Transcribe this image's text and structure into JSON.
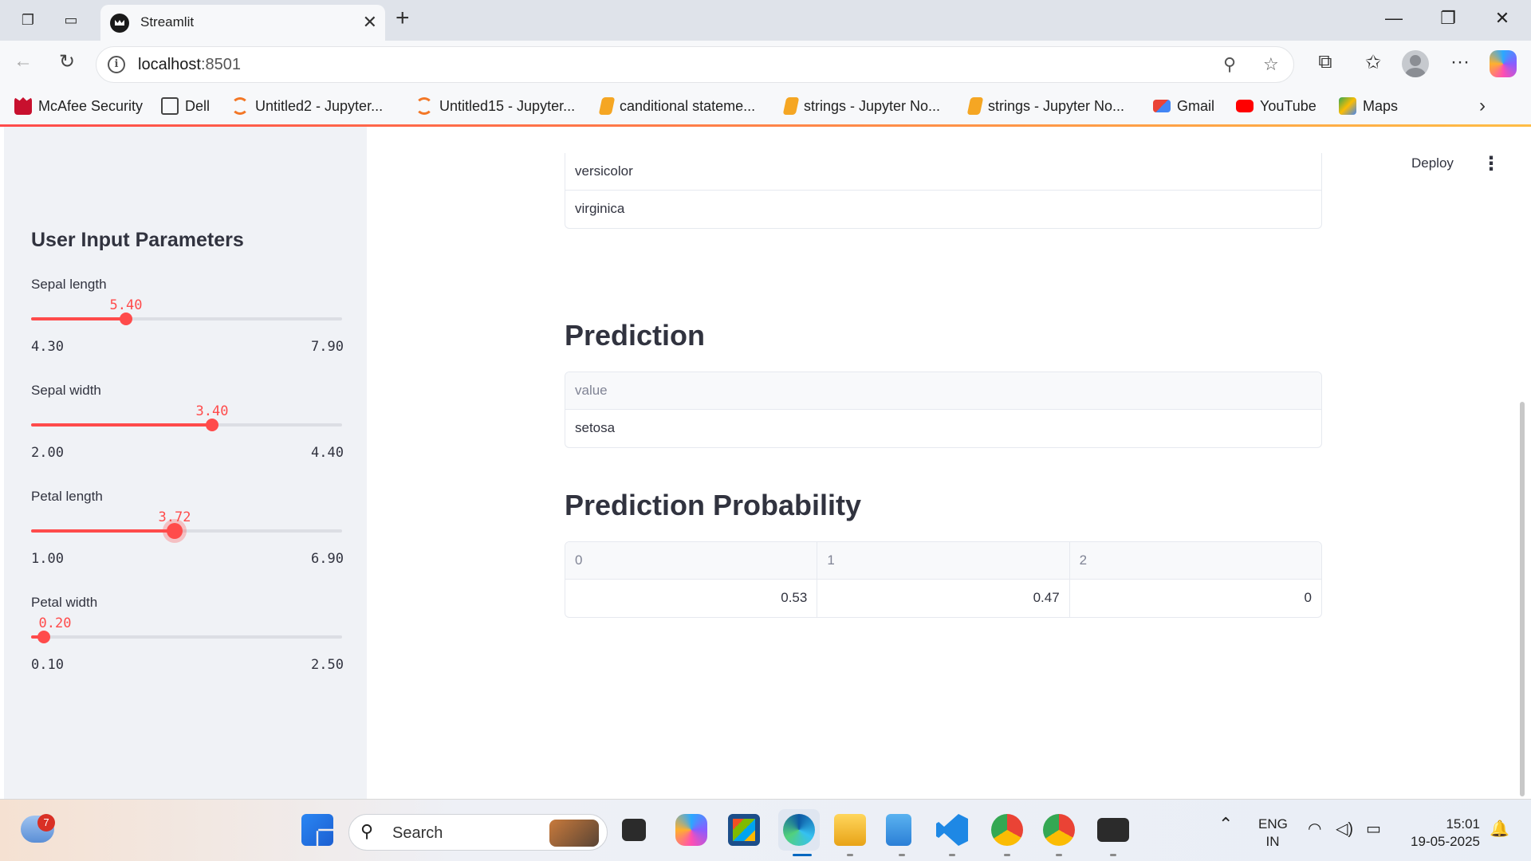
{
  "browser": {
    "tab_title": "Streamlit",
    "url_host": "localhost",
    "url_port": ":8501"
  },
  "bookmarks": [
    {
      "label": "McAfee Security",
      "icon": "mcafee-icon",
      "color": "#c8102e"
    },
    {
      "label": "Dell",
      "icon": "folder-icon",
      "color": "#555555"
    },
    {
      "label": "Untitled2 - Jupyter...",
      "icon": "jupyter-icon",
      "color": "#f37726"
    },
    {
      "label": "Untitled15 - Jupyter...",
      "icon": "jupyter-icon",
      "color": "#f37726"
    },
    {
      "label": "canditional stateme...",
      "icon": "notebook-icon",
      "color": "#f5a623"
    },
    {
      "label": "strings - Jupyter No...",
      "icon": "notebook-icon",
      "color": "#f5a623"
    },
    {
      "label": "strings - Jupyter No...",
      "icon": "notebook-icon",
      "color": "#f5a623"
    },
    {
      "label": "Gmail",
      "icon": "gmail-icon",
      "color": "#ea4335"
    },
    {
      "label": "YouTube",
      "icon": "youtube-icon",
      "color": "#ff0000"
    },
    {
      "label": "Maps",
      "icon": "maps-icon",
      "color": "#34a853"
    }
  ],
  "header": {
    "deploy_label": "Deploy"
  },
  "sidebar": {
    "title": "User Input Parameters",
    "sliders": [
      {
        "label": "Sepal length",
        "value": "5.40",
        "min": "4.30",
        "max": "7.90",
        "fraction": 0.306
      },
      {
        "label": "Sepal width",
        "value": "3.40",
        "min": "2.00",
        "max": "4.40",
        "fraction": 0.583
      },
      {
        "label": "Petal length",
        "value": "3.72",
        "min": "1.00",
        "max": "6.90",
        "fraction": 0.461
      },
      {
        "label": "Petal width",
        "value": "0.20",
        "min": "0.10",
        "max": "2.50",
        "fraction": 0.042
      }
    ]
  },
  "main": {
    "classes_table": {
      "rows": [
        "versicolor",
        "virginica"
      ]
    },
    "prediction": {
      "heading": "Prediction",
      "column": "value",
      "value": "setosa"
    },
    "probability": {
      "heading": "Prediction Probability",
      "columns": [
        "0",
        "1",
        "2"
      ],
      "values": [
        "0.53",
        "0.47",
        "0"
      ]
    }
  },
  "taskbar": {
    "weather_badge": "7",
    "search_label": "Search",
    "lang_1": "ENG",
    "lang_2": "IN",
    "time": "15:01",
    "date": "19-05-2025"
  },
  "colors": {
    "accent": "#ff4b4b",
    "sidebar_bg": "#f0f2f6"
  }
}
